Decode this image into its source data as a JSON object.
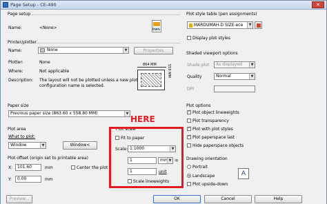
{
  "window": {
    "title": "Page Setup - CE-490",
    "close_glyph": "✕"
  },
  "page_setup": {
    "group": "Page setup",
    "name_label": "Name:",
    "name_value": "<None>",
    "dwg_icon_text": "DWG"
  },
  "printer": {
    "group": "Printer/plotter",
    "name_label": "Name:",
    "name_value": "None",
    "properties_button": "Properties",
    "plotter_label": "Plotter:",
    "plotter_value": "None",
    "where_label": "Where:",
    "where_value": "Not applicable",
    "description_label": "Description:",
    "description_value_1": "The layout will not be plotted unless a new plotter",
    "description_value_2": "configuration name is selected.",
    "preview_width": "864 MM",
    "preview_height": "559 MM"
  },
  "paper_size": {
    "group": "Paper size",
    "value": "Previous paper size (863.60 x 558.80 MM)"
  },
  "plot_area": {
    "group": "Plot area",
    "what_label": "What to plot:",
    "what_value": "Window",
    "window_button": "Window<"
  },
  "plot_offset": {
    "group": "Plot offset (origin set to printable area)",
    "x_label": "X:",
    "x_value": "101.60",
    "x_unit": "mm",
    "y_label": "Y:",
    "y_value": "0.00",
    "y_unit": "mm",
    "center_label": "Center the plot"
  },
  "plot_scale": {
    "group": "Plot scale",
    "fit_label": "Fit to paper",
    "scale_label": "Scale:",
    "scale_value": "1:1000",
    "value1": "1",
    "unit1": "mm",
    "value2": "1",
    "unit2": "unit",
    "lineweights_label": "Scale lineweights"
  },
  "annotation": {
    "text": "HERE",
    "color": "#e11b22"
  },
  "style_table": {
    "group": "Plot style table (pen assignments)",
    "value": "MARDUMAH-D SIZE-ece",
    "display_label": "Display plot styles"
  },
  "shaded": {
    "group": "Shaded viewport options",
    "shade_label": "Shade plot",
    "shade_value": "As displayed",
    "quality_label": "Quality",
    "quality_value": "Normal",
    "dpi_label": "DPI"
  },
  "plot_options": {
    "group": "Plot options",
    "items": [
      "Plot object lineweights",
      "Plot transparency",
      "Plot with plot styles",
      "Plot paperspace last",
      "Hide paperspace objects"
    ],
    "checked": [
      true,
      false,
      true,
      true,
      false
    ]
  },
  "orientation": {
    "group": "Drawing orientation",
    "portrait": "Portrait",
    "landscape": "Landscape",
    "upside_down": "Plot upside-down",
    "icon_letter": "A"
  },
  "buttons": {
    "preview": "Preview...",
    "ok": "OK",
    "cancel": "Cancel",
    "help": "Help"
  },
  "colors": {
    "accent": "#2a4d8f",
    "annotation_red": "#e11b22",
    "titlebar": "#c4d5ec"
  }
}
